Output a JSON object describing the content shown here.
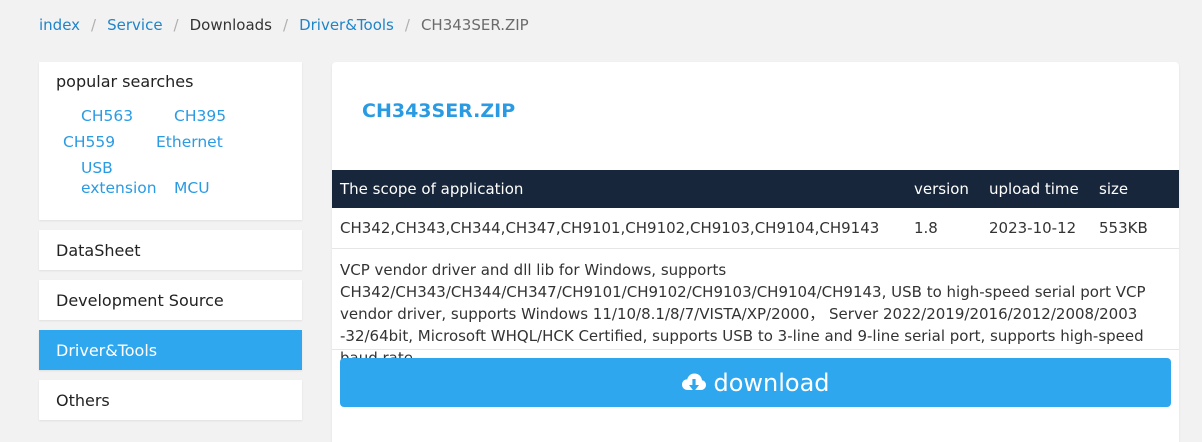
{
  "breadcrumb": {
    "index": "index",
    "service": "Service",
    "downloads": "Downloads",
    "driver_tools": "Driver&Tools",
    "current": "CH343SER.ZIP",
    "separator": "/"
  },
  "sidebar": {
    "popular_title": "popular searches",
    "tags": [
      "CH563",
      "CH395",
      "CH559",
      "Ethernet",
      "USB extension",
      "MCU"
    ],
    "menu": [
      {
        "label": "DataSheet",
        "active": false
      },
      {
        "label": "Development Source",
        "active": false
      },
      {
        "label": "Driver&Tools",
        "active": true
      },
      {
        "label": "Others",
        "active": false
      }
    ]
  },
  "file": {
    "title": "CH343SER.ZIP",
    "table": {
      "headers": {
        "scope": "The scope of application",
        "version": "version",
        "upload_time": "upload time",
        "size": "size"
      },
      "row": {
        "scope": "CH342,CH343,CH344,CH347,CH9101,CH9102,CH9103,CH9104,CH9143",
        "version": "1.8",
        "upload_time": "2023-10-12",
        "size": "553KB"
      }
    },
    "description": "VCP vendor driver and dll lib for Windows, supports CH342/CH343/CH344/CH347/CH9101/CH9102/CH9103/CH9104/CH9143, USB to high-speed serial port VCP vendor driver, supports Windows 11/10/8.1/8/7/VISTA/XP/2000， Server 2022/2019/2016/2012/2008/2003 -32/64bit, Microsoft WHQL/HCK Certified, supports USB to 3-line and 9-line serial port, supports high-speed baud rate.",
    "download_label": "download",
    "download_icon": "cloud-download-icon"
  },
  "colors": {
    "accent": "#2ea7ef",
    "link": "#1f84c8",
    "table_header": "#17263a",
    "background": "#f2f2f2"
  }
}
